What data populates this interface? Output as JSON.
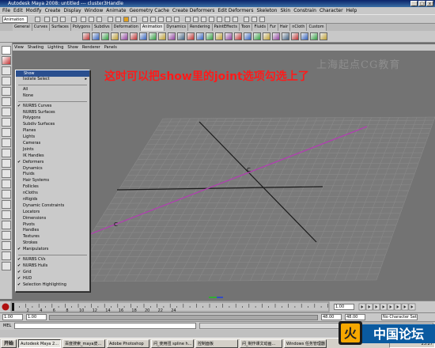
{
  "window": {
    "title": "Autodesk Maya 2008: untitled  ---  cluster3Handle",
    "buttons": [
      "_",
      "□",
      "x"
    ]
  },
  "menubar": [
    "File",
    "Edit",
    "Modify",
    "Create",
    "Display",
    "Window",
    "Animate",
    "Geometry Cache",
    "Create Deformers",
    "Edit Deformers",
    "Skeleton",
    "Skin",
    "Constrain",
    "Character",
    "Help"
  ],
  "statusline": {
    "mode": "Animation"
  },
  "shelf_tabs": [
    "General",
    "Curves",
    "Surfaces",
    "Polygons",
    "Subdivs",
    "Deformation",
    "Animation",
    "Dynamics",
    "Rendering",
    "PaintEffects",
    "Toon",
    "Fluids",
    "Fur",
    "Hair",
    "nCloth",
    "Custom"
  ],
  "shelf_active_tab": "Animation",
  "viewport_menu": [
    "View",
    "Shading",
    "Lighting",
    "Show",
    "Renderer",
    "Panels"
  ],
  "annotation": "这时可以把show里的joint选项勾选上了",
  "watermark": "上海起点CG教育",
  "show_menu": {
    "header": "Show",
    "items": [
      {
        "label": "Isolate Select",
        "checked": false,
        "submenu": true
      },
      {
        "sep": true
      },
      {
        "label": "All",
        "checked": false
      },
      {
        "label": "None",
        "checked": false
      },
      {
        "sep": true
      },
      {
        "label": "NURBS Curves",
        "checked": true
      },
      {
        "label": "NURBS Surfaces",
        "checked": false
      },
      {
        "label": "Polygons",
        "checked": false
      },
      {
        "label": "Subdiv Surfaces",
        "checked": false
      },
      {
        "label": "Planes",
        "checked": false
      },
      {
        "label": "Lights",
        "checked": false
      },
      {
        "label": "Cameras",
        "checked": false
      },
      {
        "label": "Joints",
        "checked": false
      },
      {
        "label": "IK Handles",
        "checked": false
      },
      {
        "label": "Deformers",
        "checked": true
      },
      {
        "label": "Dynamics",
        "checked": false
      },
      {
        "label": "Fluids",
        "checked": false
      },
      {
        "label": "Hair Systems",
        "checked": false
      },
      {
        "label": "Follicles",
        "checked": false
      },
      {
        "label": "nCloths",
        "checked": false
      },
      {
        "label": "nRigids",
        "checked": false
      },
      {
        "label": "Dynamic Constraints",
        "checked": false
      },
      {
        "label": "Locators",
        "checked": false
      },
      {
        "label": "Dimensions",
        "checked": false
      },
      {
        "label": "Pivots",
        "checked": false
      },
      {
        "label": "Handles",
        "checked": false
      },
      {
        "label": "Textures",
        "checked": false
      },
      {
        "label": "Strokes",
        "checked": false
      },
      {
        "label": "Manipulators",
        "checked": true
      },
      {
        "sep": true
      },
      {
        "label": "NURBS CVs",
        "checked": true
      },
      {
        "label": "NURBS Hulls",
        "checked": true
      },
      {
        "label": "Grid",
        "checked": true
      },
      {
        "label": "HUD",
        "checked": true
      },
      {
        "label": "Selection Highlighting",
        "checked": true
      }
    ]
  },
  "timeslider": {
    "ticks": [
      "2",
      "4",
      "6",
      "8",
      "10",
      "12",
      "14",
      "16",
      "18",
      "20",
      "22",
      "24"
    ],
    "current_frame": "1.00"
  },
  "rangeslider": {
    "start": "1.00",
    "inner_start": "1.00",
    "inner_end": "48.00",
    "end": "48.00",
    "character_set": "No Character Set"
  },
  "cmdline": {
    "label": "MEL"
  },
  "taskbar": {
    "start": "开始",
    "tasks": [
      "Autodesk Maya 2...",
      "百度搜索_maya皮...",
      "Adobe Photoshop",
      "问_使用扭 spline h...",
      "控制面板",
      "问_制作课文动画...",
      "Windows 任务管理器"
    ],
    "active_index": 0,
    "clock": "23:27"
  },
  "logo": {
    "text": "中国论坛",
    "letter": "火"
  },
  "colors": {
    "annotation": "#ff1a1a",
    "curve": "#b040b0",
    "grid": "#8a8a8a",
    "axis": "#1a1a1a"
  }
}
